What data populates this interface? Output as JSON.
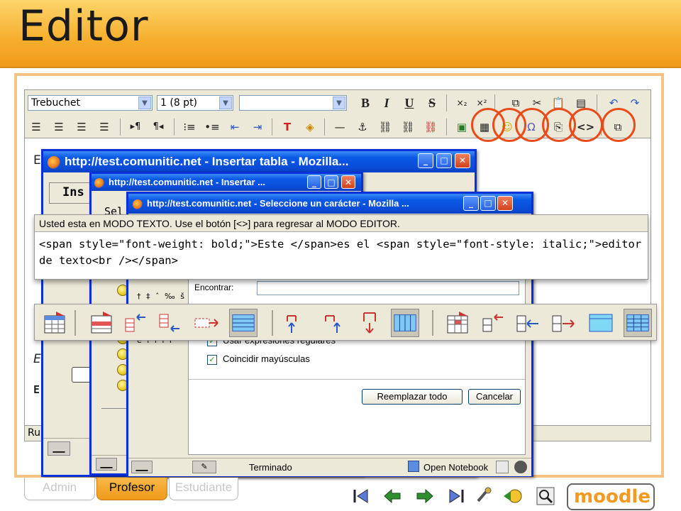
{
  "slide": {
    "title": "Editor"
  },
  "toolbar": {
    "font_family": "Trebuchet",
    "font_size": "1 (8 pt)",
    "format": "",
    "bold": "B",
    "italic": "I",
    "underline": "U",
    "strike": "S",
    "subscript": "×₂",
    "superscript": "×²"
  },
  "editor": {
    "line1": "E",
    "line2": "E",
    "line3": "E",
    "status": "Ru"
  },
  "windows": {
    "table": {
      "title": "http://test.comunitic.net - Insertar tabla - Mozilla...",
      "tab": "Ins"
    },
    "insert": {
      "title": "http://test.comunitic.net - Insertar ...",
      "label": "Sel"
    },
    "char": {
      "title": "http://test.comunitic.net - Seleccione un carácter - Mozilla ...",
      "chars": "† ‡ ˆ ‰ š",
      "chars2": "é ì í î ï"
    },
    "find": {
      "find_label": "Encontrar:",
      "regex_label": "Usar expresiones regulares",
      "case_label": "Coincidir mayúsculas",
      "replace_all": "Reemplazar todo",
      "cancel": "Cancelar",
      "status_text": "Terminado",
      "open_notebook": "Open Notebook"
    }
  },
  "textmode": {
    "message": "Usted esta en MODO TEXTO. Use el botón [<>] para regresar al MODO EDITOR.",
    "code": "<span style=\"font-weight: bold;\">Este </span>es el <span style=\"font-style: italic;\">editor de texto<br /></span>"
  },
  "tabs": {
    "admin": "Admin",
    "profesor": "Profesor",
    "estudiante": "Estudiante"
  },
  "logo": {
    "text": "moodle"
  },
  "colors": {
    "title_band": "#f6ae2d",
    "frame": "#f7c385",
    "highlight": "#e84c1a",
    "xp_blue": "#0831d9"
  }
}
